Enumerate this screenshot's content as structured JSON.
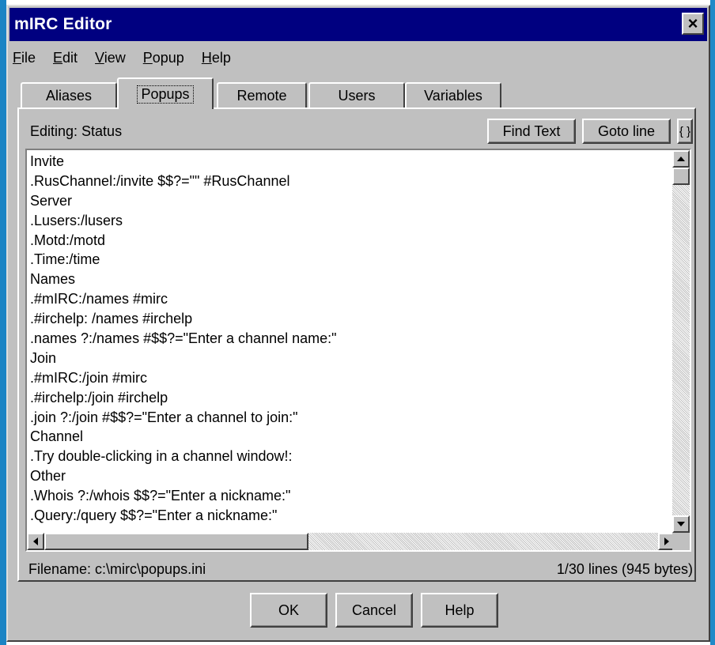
{
  "window": {
    "title": "mIRC Editor",
    "close_label": "×"
  },
  "menu": [
    {
      "first": "F",
      "rest": "ile"
    },
    {
      "first": "E",
      "rest": "dit"
    },
    {
      "first": "V",
      "rest": "iew"
    },
    {
      "first": "P",
      "rest": "opup"
    },
    {
      "first": "H",
      "rest": "elp"
    }
  ],
  "tabs": [
    {
      "label": "Aliases"
    },
    {
      "label": "Popups",
      "active": true
    },
    {
      "label": "Remote"
    },
    {
      "label": "Users"
    },
    {
      "label": "Variables"
    }
  ],
  "toolbar": {
    "editing_label": "Editing: Status",
    "find_text_label": "Find Text",
    "goto_line_label": "Goto line",
    "braces_label": "{ }"
  },
  "editor": {
    "lines": [
      "Invite",
      ".RusChannel:/invite $$?=\"\" #RusChannel",
      "Server",
      ".Lusers:/lusers",
      ".Motd:/motd",
      ".Time:/time",
      "Names",
      ".#mIRC:/names #mirc",
      ".#irchelp: /names #irchelp",
      ".names ?:/names #$$?=\"Enter a channel name:\"",
      "Join",
      ".#mIRC:/join #mirc",
      ".#irchelp:/join #irchelp",
      ".join ?:/join #$$?=\"Enter a channel to join:\"",
      "Channel",
      ".Try double-clicking in a channel window!:",
      "Other",
      ".Whois ?:/whois $$?=\"Enter a nickname:\"",
      ".Query:/query $$?=\"Enter a nickname:\""
    ]
  },
  "status": {
    "filename": "Filename: c:\\mirc\\popups.ini",
    "line_info": "1/30 lines (945 bytes)"
  },
  "buttons": {
    "ok": "OK",
    "cancel": "Cancel",
    "help": "Help"
  }
}
